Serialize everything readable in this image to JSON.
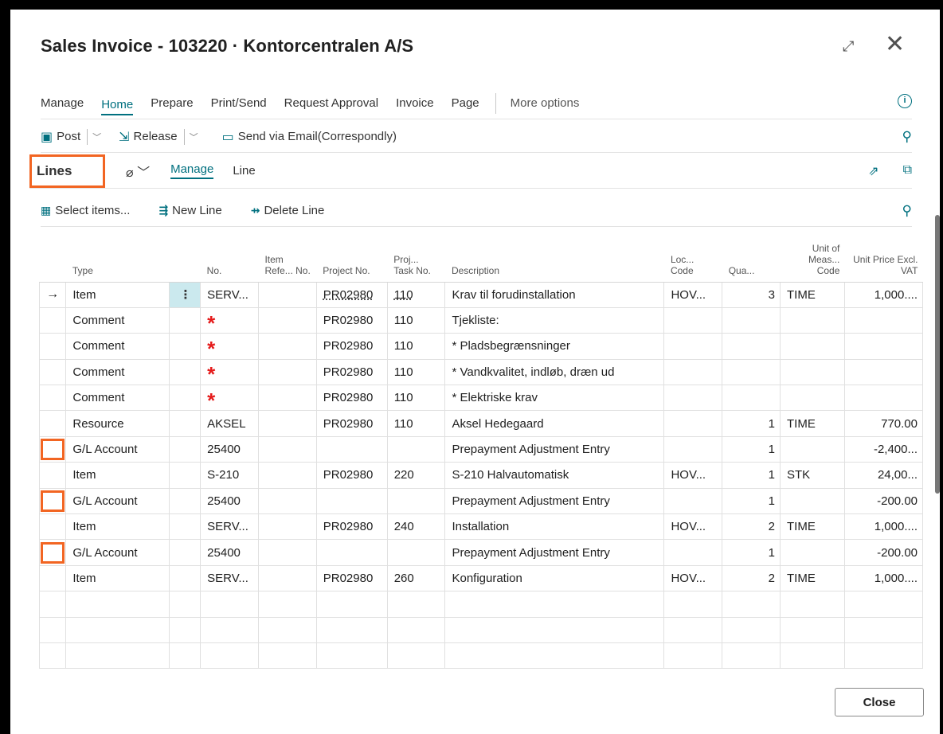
{
  "window": {
    "title": "Sales Invoice - 103220 · Kontorcentralen A/S",
    "expand_icon": "expand-diagonal-icon",
    "close_icon": "close-x-icon"
  },
  "actionbar": {
    "tabs": [
      "Manage",
      "Home",
      "Prepare",
      "Print/Send",
      "Request Approval",
      "Invoice",
      "Page"
    ],
    "active_tab": "Home",
    "more": "More options"
  },
  "commands": {
    "post": "Post",
    "release": "Release",
    "send_email": "Send via Email(Correspondly)"
  },
  "lines": {
    "title": "Lines",
    "tab_manage": "Manage",
    "tab_line": "Line",
    "select_items": "Select items...",
    "new_line": "New Line",
    "delete_line": "Delete Line"
  },
  "columns": {
    "type": "Type",
    "no": "No.",
    "item_ref": "Item Refe... No.",
    "project_no": "Project No.",
    "proj_task": "Proj... Task No.",
    "description": "Description",
    "loc_code": "Loc... Code",
    "qty": "Qua...",
    "uom": "Unit of Meas... Code",
    "unit_price": "Unit Price Excl. VAT"
  },
  "rows": [
    {
      "type": "Item",
      "no": "SERV...",
      "project": "PR02980",
      "task": "110",
      "desc": "Krav til forudinstallation",
      "loc": "HOV...",
      "qty": "3",
      "uom": "TIME",
      "price": "1,000...."
    },
    {
      "type": "Comment",
      "no": "*",
      "project": "PR02980",
      "task": "110",
      "desc": "Tjekliste:",
      "loc": "",
      "qty": "",
      "uom": "",
      "price": ""
    },
    {
      "type": "Comment",
      "no": "*",
      "project": "PR02980",
      "task": "110",
      "desc": "* Pladsbegrænsninger",
      "loc": "",
      "qty": "",
      "uom": "",
      "price": ""
    },
    {
      "type": "Comment",
      "no": "*",
      "project": "PR02980",
      "task": "110",
      "desc": "* Vandkvalitet, indløb, dræn ud",
      "loc": "",
      "qty": "",
      "uom": "",
      "price": ""
    },
    {
      "type": "Comment",
      "no": "*",
      "project": "PR02980",
      "task": "110",
      "desc": "* Elektriske krav",
      "loc": "",
      "qty": "",
      "uom": "",
      "price": ""
    },
    {
      "type": "Resource",
      "no": "AKSEL",
      "project": "PR02980",
      "task": "110",
      "desc": "Aksel Hedegaard",
      "loc": "",
      "qty": "1",
      "uom": "TIME",
      "price": "770.00"
    },
    {
      "type": "G/L Account",
      "no": "25400",
      "project": "",
      "task": "",
      "desc": "Prepayment Adjustment Entry",
      "loc": "",
      "qty": "1",
      "uom": "",
      "price": "-2,400..."
    },
    {
      "type": "Item",
      "no": "S-210",
      "project": "PR02980",
      "task": "220",
      "desc": "S-210 Halvautomatisk",
      "loc": "HOV...",
      "qty": "1",
      "uom": "STK",
      "price": "24,00..."
    },
    {
      "type": "G/L Account",
      "no": "25400",
      "project": "",
      "task": "",
      "desc": "Prepayment Adjustment Entry",
      "loc": "",
      "qty": "1",
      "uom": "",
      "price": "-200.00"
    },
    {
      "type": "Item",
      "no": "SERV...",
      "project": "PR02980",
      "task": "240",
      "desc": "Installation",
      "loc": "HOV...",
      "qty": "2",
      "uom": "TIME",
      "price": "1,000...."
    },
    {
      "type": "G/L Account",
      "no": "25400",
      "project": "",
      "task": "",
      "desc": "Prepayment Adjustment Entry",
      "loc": "",
      "qty": "1",
      "uom": "",
      "price": "-200.00"
    },
    {
      "type": "Item",
      "no": "SERV...",
      "project": "PR02980",
      "task": "260",
      "desc": "Konfiguration",
      "loc": "HOV...",
      "qty": "2",
      "uom": "TIME",
      "price": "1,000...."
    }
  ],
  "footer": {
    "close": "Close"
  },
  "colors": {
    "accent": "#00707f",
    "highlight_box": "#f26522",
    "required_star": "#e51b1b",
    "selected_cell": "#cbe9ee"
  }
}
